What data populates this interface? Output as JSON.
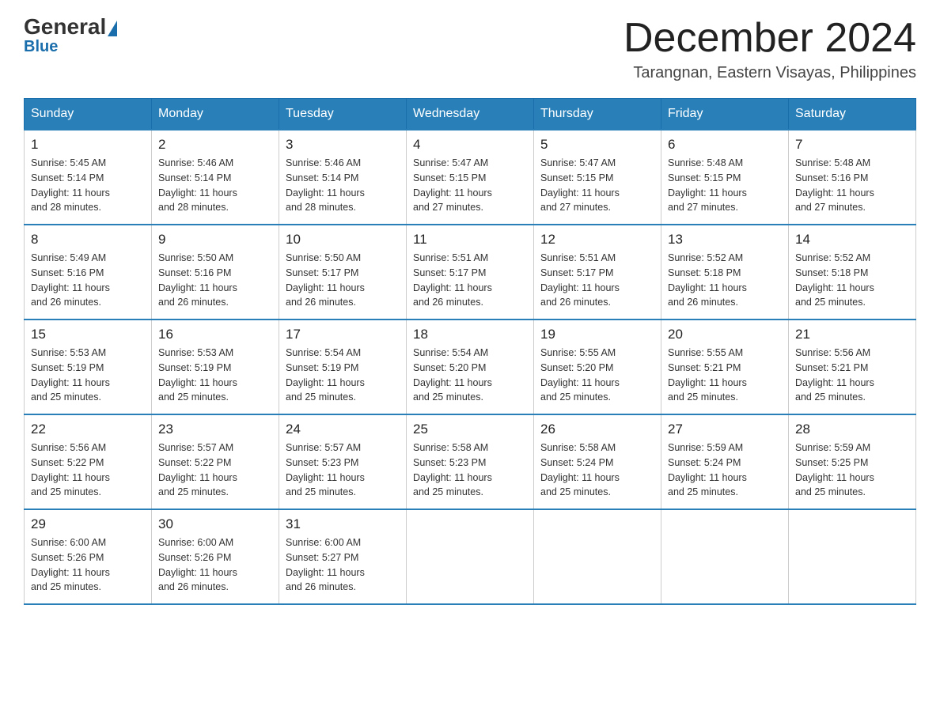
{
  "logo": {
    "general": "General",
    "blue": "Blue",
    "triangle": "▶"
  },
  "header": {
    "month_year": "December 2024",
    "location": "Tarangnan, Eastern Visayas, Philippines"
  },
  "days_of_week": [
    "Sunday",
    "Monday",
    "Tuesday",
    "Wednesday",
    "Thursday",
    "Friday",
    "Saturday"
  ],
  "weeks": [
    {
      "days": [
        {
          "num": "1",
          "sunrise": "5:45 AM",
          "sunset": "5:14 PM",
          "daylight": "11 hours and 28 minutes."
        },
        {
          "num": "2",
          "sunrise": "5:46 AM",
          "sunset": "5:14 PM",
          "daylight": "11 hours and 28 minutes."
        },
        {
          "num": "3",
          "sunrise": "5:46 AM",
          "sunset": "5:14 PM",
          "daylight": "11 hours and 28 minutes."
        },
        {
          "num": "4",
          "sunrise": "5:47 AM",
          "sunset": "5:15 PM",
          "daylight": "11 hours and 27 minutes."
        },
        {
          "num": "5",
          "sunrise": "5:47 AM",
          "sunset": "5:15 PM",
          "daylight": "11 hours and 27 minutes."
        },
        {
          "num": "6",
          "sunrise": "5:48 AM",
          "sunset": "5:15 PM",
          "daylight": "11 hours and 27 minutes."
        },
        {
          "num": "7",
          "sunrise": "5:48 AM",
          "sunset": "5:16 PM",
          "daylight": "11 hours and 27 minutes."
        }
      ]
    },
    {
      "days": [
        {
          "num": "8",
          "sunrise": "5:49 AM",
          "sunset": "5:16 PM",
          "daylight": "11 hours and 26 minutes."
        },
        {
          "num": "9",
          "sunrise": "5:50 AM",
          "sunset": "5:16 PM",
          "daylight": "11 hours and 26 minutes."
        },
        {
          "num": "10",
          "sunrise": "5:50 AM",
          "sunset": "5:17 PM",
          "daylight": "11 hours and 26 minutes."
        },
        {
          "num": "11",
          "sunrise": "5:51 AM",
          "sunset": "5:17 PM",
          "daylight": "11 hours and 26 minutes."
        },
        {
          "num": "12",
          "sunrise": "5:51 AM",
          "sunset": "5:17 PM",
          "daylight": "11 hours and 26 minutes."
        },
        {
          "num": "13",
          "sunrise": "5:52 AM",
          "sunset": "5:18 PM",
          "daylight": "11 hours and 26 minutes."
        },
        {
          "num": "14",
          "sunrise": "5:52 AM",
          "sunset": "5:18 PM",
          "daylight": "11 hours and 25 minutes."
        }
      ]
    },
    {
      "days": [
        {
          "num": "15",
          "sunrise": "5:53 AM",
          "sunset": "5:19 PM",
          "daylight": "11 hours and 25 minutes."
        },
        {
          "num": "16",
          "sunrise": "5:53 AM",
          "sunset": "5:19 PM",
          "daylight": "11 hours and 25 minutes."
        },
        {
          "num": "17",
          "sunrise": "5:54 AM",
          "sunset": "5:19 PM",
          "daylight": "11 hours and 25 minutes."
        },
        {
          "num": "18",
          "sunrise": "5:54 AM",
          "sunset": "5:20 PM",
          "daylight": "11 hours and 25 minutes."
        },
        {
          "num": "19",
          "sunrise": "5:55 AM",
          "sunset": "5:20 PM",
          "daylight": "11 hours and 25 minutes."
        },
        {
          "num": "20",
          "sunrise": "5:55 AM",
          "sunset": "5:21 PM",
          "daylight": "11 hours and 25 minutes."
        },
        {
          "num": "21",
          "sunrise": "5:56 AM",
          "sunset": "5:21 PM",
          "daylight": "11 hours and 25 minutes."
        }
      ]
    },
    {
      "days": [
        {
          "num": "22",
          "sunrise": "5:56 AM",
          "sunset": "5:22 PM",
          "daylight": "11 hours and 25 minutes."
        },
        {
          "num": "23",
          "sunrise": "5:57 AM",
          "sunset": "5:22 PM",
          "daylight": "11 hours and 25 minutes."
        },
        {
          "num": "24",
          "sunrise": "5:57 AM",
          "sunset": "5:23 PM",
          "daylight": "11 hours and 25 minutes."
        },
        {
          "num": "25",
          "sunrise": "5:58 AM",
          "sunset": "5:23 PM",
          "daylight": "11 hours and 25 minutes."
        },
        {
          "num": "26",
          "sunrise": "5:58 AM",
          "sunset": "5:24 PM",
          "daylight": "11 hours and 25 minutes."
        },
        {
          "num": "27",
          "sunrise": "5:59 AM",
          "sunset": "5:24 PM",
          "daylight": "11 hours and 25 minutes."
        },
        {
          "num": "28",
          "sunrise": "5:59 AM",
          "sunset": "5:25 PM",
          "daylight": "11 hours and 25 minutes."
        }
      ]
    },
    {
      "days": [
        {
          "num": "29",
          "sunrise": "6:00 AM",
          "sunset": "5:26 PM",
          "daylight": "11 hours and 25 minutes."
        },
        {
          "num": "30",
          "sunrise": "6:00 AM",
          "sunset": "5:26 PM",
          "daylight": "11 hours and 26 minutes."
        },
        {
          "num": "31",
          "sunrise": "6:00 AM",
          "sunset": "5:27 PM",
          "daylight": "11 hours and 26 minutes."
        },
        {
          "num": "",
          "sunrise": "",
          "sunset": "",
          "daylight": ""
        },
        {
          "num": "",
          "sunrise": "",
          "sunset": "",
          "daylight": ""
        },
        {
          "num": "",
          "sunrise": "",
          "sunset": "",
          "daylight": ""
        },
        {
          "num": "",
          "sunrise": "",
          "sunset": "",
          "daylight": ""
        }
      ]
    }
  ],
  "labels": {
    "sunrise": "Sunrise:",
    "sunset": "Sunset:",
    "daylight": "Daylight:"
  }
}
